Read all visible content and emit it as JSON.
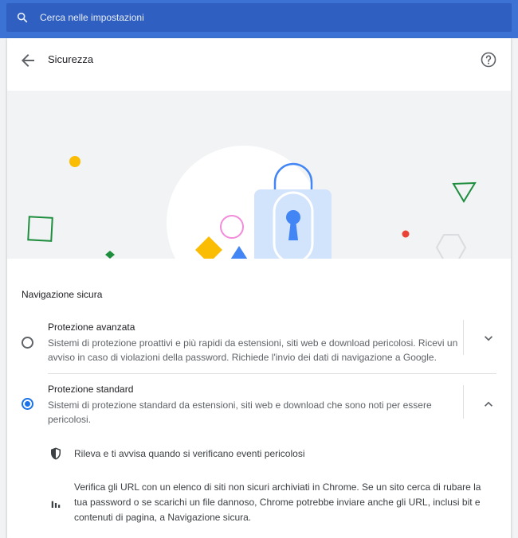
{
  "search": {
    "placeholder": "Cerca nelle impostazioni",
    "value": ""
  },
  "header": {
    "title": "Sicurezza",
    "back_icon": "arrow-back-icon",
    "help_icon": "help-icon"
  },
  "safe_browsing": {
    "title": "Navigazione sicura",
    "options": [
      {
        "label": "Protezione avanzata",
        "description": "Sistemi di protezione proattivi e più rapidi da estensioni, siti web e download pericolosi. Ricevi un avviso in caso di violazioni della password. Richiede l'invio dei dati di navigazione a Google.",
        "selected": false,
        "expanded": false
      },
      {
        "label": "Protezione standard",
        "description": "Sistemi di protezione standard da estensioni, siti web e download che sono noti per essere pericolosi.",
        "selected": true,
        "expanded": true
      }
    ],
    "features": [
      {
        "icon": "shield-icon",
        "text": "Rileva e ti avvisa quando si verificano eventi pericolosi"
      },
      {
        "icon": "bar-chart-icon",
        "text": "Verifica gli URL con un elenco di siti non sicuri archiviati in Chrome. Se un sito cerca di rubare la tua password o se scarichi un file dannoso, Chrome potrebbe inviare anche gli URL, inclusi bit e contenuti di pagina, a Navigazione sicura."
      }
    ]
  },
  "colors": {
    "accent": "#1a73e8",
    "topbar": "#3b72d4",
    "search_bg": "#2f5fc0"
  }
}
